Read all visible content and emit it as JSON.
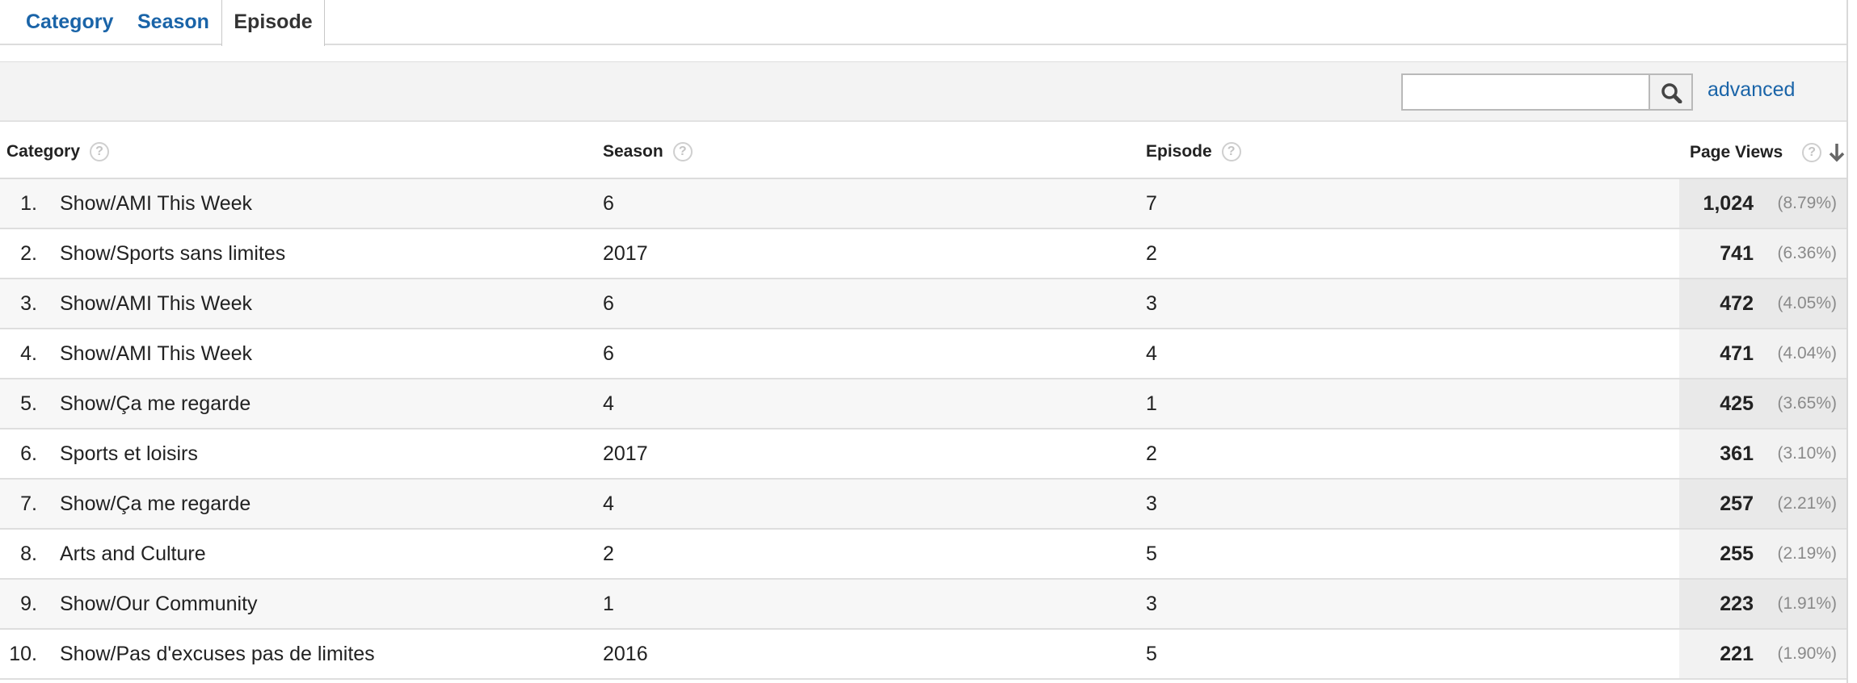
{
  "tabs": [
    {
      "label": "Category",
      "active": false
    },
    {
      "label": "Season",
      "active": false
    },
    {
      "label": "Episode",
      "active": true
    }
  ],
  "toolbar": {
    "search_value": "",
    "search_icon": "magnifier-icon",
    "advanced_label": "advanced"
  },
  "table": {
    "headers": {
      "category": "Category",
      "season": "Season",
      "episode": "Episode",
      "page_views": "Page Views",
      "help_glyph": "?",
      "sort_icon": "arrow-down-icon"
    },
    "rows": [
      {
        "index": "1.",
        "category": "Show/AMI This Week",
        "season": "6",
        "episode": "7",
        "views": "1,024",
        "pct": "(8.79%)"
      },
      {
        "index": "2.",
        "category": "Show/Sports sans limites",
        "season": "2017",
        "episode": "2",
        "views": "741",
        "pct": "(6.36%)"
      },
      {
        "index": "3.",
        "category": "Show/AMI This Week",
        "season": "6",
        "episode": "3",
        "views": "472",
        "pct": "(4.05%)"
      },
      {
        "index": "4.",
        "category": "Show/AMI This Week",
        "season": "6",
        "episode": "4",
        "views": "471",
        "pct": "(4.04%)"
      },
      {
        "index": "5.",
        "category": "Show/Ça me regarde",
        "season": "4",
        "episode": "1",
        "views": "425",
        "pct": "(3.65%)"
      },
      {
        "index": "6.",
        "category": "Sports et loisirs",
        "season": "2017",
        "episode": "2",
        "views": "361",
        "pct": "(3.10%)"
      },
      {
        "index": "7.",
        "category": "Show/Ça me regarde",
        "season": "4",
        "episode": "3",
        "views": "257",
        "pct": "(2.21%)"
      },
      {
        "index": "8.",
        "category": "Arts and Culture",
        "season": "2",
        "episode": "5",
        "views": "255",
        "pct": "(2.19%)"
      },
      {
        "index": "9.",
        "category": "Show/Our Community",
        "season": "1",
        "episode": "3",
        "views": "223",
        "pct": "(1.91%)"
      },
      {
        "index": "10.",
        "category": "Show/Pas d'excuses pas de limites",
        "season": "2016",
        "episode": "5",
        "views": "221",
        "pct": "(1.90%)"
      }
    ]
  },
  "colors": {
    "link": "#1a64a8",
    "toolbar_bg": "#f3f3f3",
    "row_alt_bg": "#f7f7f7",
    "metric_col_bg": "#e9e9e9",
    "muted_text": "#8a8a8a"
  }
}
